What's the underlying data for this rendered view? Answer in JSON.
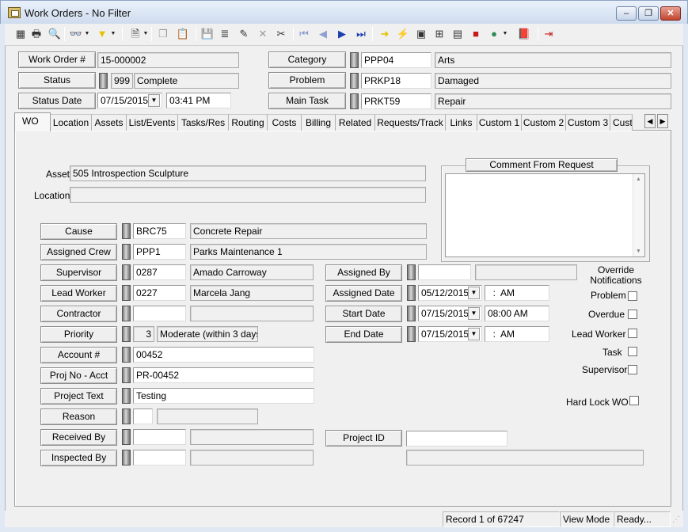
{
  "window": {
    "title": "Work Orders - No Filter",
    "minimize": "–",
    "restore": "❐",
    "close": "✕"
  },
  "toolbar": {
    "icons": [
      {
        "name": "grid-icon",
        "glyph": "▦"
      },
      {
        "name": "print-icon",
        "glyph": "🖶"
      },
      {
        "name": "print-preview-icon",
        "glyph": "🔍"
      },
      {
        "name": "binoculars-icon",
        "glyph": "👓"
      },
      {
        "name": "filter-icon",
        "glyph": "▼"
      },
      {
        "name": "document-icon",
        "glyph": "🗎"
      },
      {
        "name": "copy-icon",
        "glyph": "❐"
      },
      {
        "name": "paste-icon",
        "glyph": "📋"
      },
      {
        "name": "save-icon",
        "glyph": "💾"
      },
      {
        "name": "layers-icon",
        "glyph": "≣"
      },
      {
        "name": "pencil-icon",
        "glyph": "✎"
      },
      {
        "name": "delete-icon",
        "glyph": "✕"
      },
      {
        "name": "scissors-icon",
        "glyph": "✂"
      },
      {
        "name": "first-record-icon",
        "glyph": "⏮"
      },
      {
        "name": "previous-record-icon",
        "glyph": "◀"
      },
      {
        "name": "next-record-icon",
        "glyph": "▶"
      },
      {
        "name": "last-record-icon",
        "glyph": "⏭"
      },
      {
        "name": "arrow-right-icon",
        "glyph": "➜"
      },
      {
        "name": "lightning-icon",
        "glyph": "⚡"
      },
      {
        "name": "map-icon",
        "glyph": "▣"
      },
      {
        "name": "hierarchy-icon",
        "glyph": "⊞"
      },
      {
        "name": "image-icon",
        "glyph": "▤"
      },
      {
        "name": "toolbox-icon",
        "glyph": "■"
      },
      {
        "name": "globe-icon",
        "glyph": "●"
      },
      {
        "name": "book-icon",
        "glyph": "📕"
      },
      {
        "name": "exit-icon",
        "glyph": "⇥"
      }
    ],
    "colors": {
      "nav": "#1f3fae",
      "yellow": "#e5c300",
      "red": "#c51a1a",
      "green": "#2e8b57"
    }
  },
  "header": {
    "work_order_label": "Work Order #",
    "work_order_value": "15-000002",
    "status_label": "Status",
    "status_code": "999",
    "status_value": "Complete",
    "status_date_label": "Status Date",
    "status_date_value": "07/15/2015",
    "status_time_value": "03:41 PM",
    "category_label": "Category",
    "category_code": "PPP04",
    "category_value": "Arts",
    "problem_label": "Problem",
    "problem_code": "PRKP18",
    "problem_value": "Damaged",
    "main_task_label": "Main Task",
    "main_task_code": "PRKT59",
    "main_task_value": "Repair"
  },
  "tabs": [
    "WO",
    "Location",
    "Assets",
    "List/Events",
    "Tasks/Res",
    "Routing",
    "Costs",
    "Billing",
    "Related",
    "Requests/Track",
    "Links",
    "Custom 1",
    "Custom 2",
    "Custom 3",
    "Custom"
  ],
  "scroll_left": "◀",
  "scroll_right": "▶",
  "wo": {
    "asset_label": "Asset",
    "asset_value": "505 Introspection Sculpture",
    "location_label": "Location",
    "location_value": "",
    "comment_label": "Comment From Request",
    "comment_value": "",
    "cause_label": "Cause",
    "cause_code": "BRC75",
    "cause_value": "Concrete Repair",
    "crew_label": "Assigned Crew",
    "crew_code": "PPP1",
    "crew_value": "Parks Maintenance 1",
    "supervisor_label": "Supervisor",
    "supervisor_code": "0287",
    "supervisor_value": "Amado Carroway",
    "lead_label": "Lead Worker",
    "lead_code": "0227",
    "lead_value": "Marcela Jang",
    "contractor_label": "Contractor",
    "contractor_code": "",
    "contractor_value": "",
    "priority_label": "Priority",
    "priority_code": "3",
    "priority_value": "Moderate (within 3 days)",
    "account_label": "Account #",
    "account_value": "00452",
    "projno_label": "Proj No - Acct",
    "projno_value": "PR-00452",
    "projtext_label": "Project Text",
    "projtext_value": "Testing",
    "reason_label": "Reason",
    "reason_code": "",
    "reason_value": "",
    "received_label": "Received By",
    "received_code": "",
    "received_value": "",
    "inspected_label": "Inspected By",
    "inspected_code": "",
    "inspected_value": "",
    "assigned_by_label": "Assigned By",
    "assigned_by_code": "",
    "assigned_by_value": "",
    "assigned_date_label": "Assigned Date",
    "assigned_date_value": "05/12/2015",
    "assigned_time_value": "  :  AM",
    "start_date_label": "Start Date",
    "start_date_value": "07/15/2015",
    "start_time_value": "08:00 AM",
    "end_date_label": "End Date",
    "end_date_value": "07/15/2015",
    "end_time_value": "  :  AM",
    "project_id_label": "Project ID",
    "project_id_value": "",
    "project_desc_value": "",
    "override_title": "Override Notifications",
    "override_problem": "Problem",
    "override_overdue": "Overdue",
    "override_lead": "Lead Worker",
    "override_task": "Task",
    "override_supervisor": "Supervisor",
    "hard_lock_label": "Hard Lock WO"
  },
  "statusbar": {
    "record": "Record 1 of 67247",
    "mode": "View Mode",
    "state": "Ready..."
  }
}
